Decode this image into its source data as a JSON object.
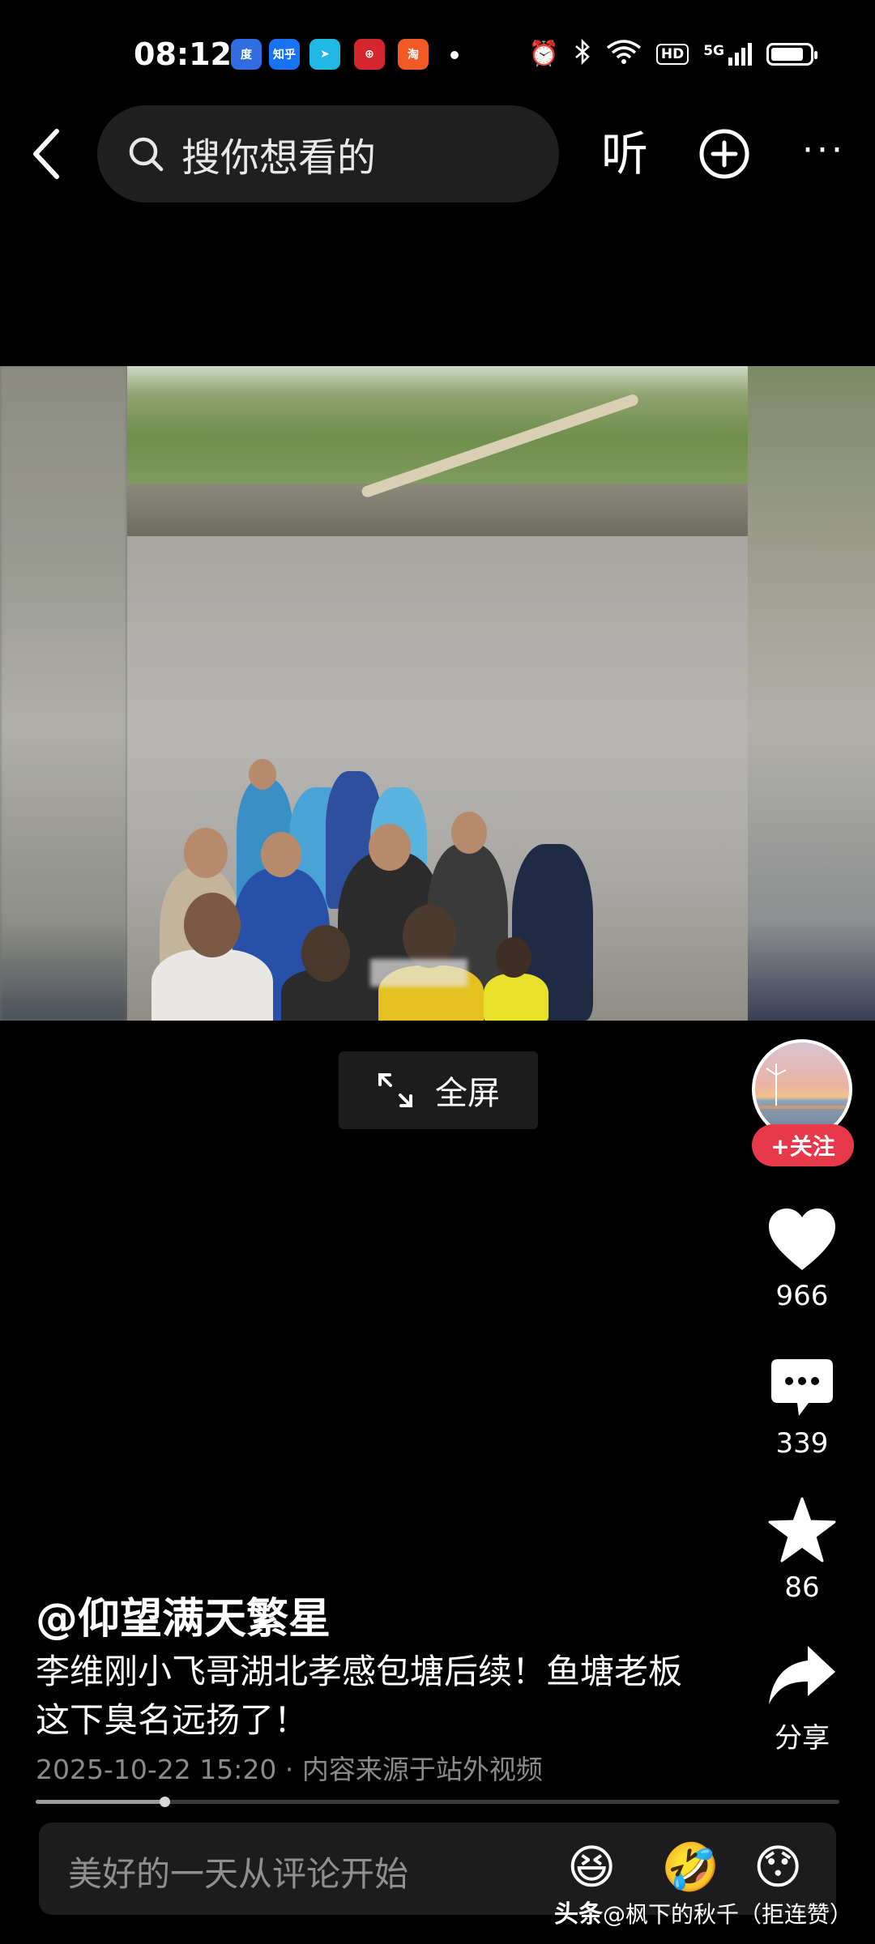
{
  "status_bar": {
    "time": "08:12",
    "apps": [
      {
        "name": "baidu-app-icon",
        "text": "度",
        "color": "#2f6de1"
      },
      {
        "name": "zhihu-app-icon",
        "text": "知乎",
        "color": "#1772f6"
      },
      {
        "name": "navigation-app-icon",
        "text": "➤",
        "color": "#22b8e6"
      },
      {
        "name": "unionpay-app-icon",
        "text": "⊕",
        "color": "#d6262d"
      },
      {
        "name": "shopping-app-icon",
        "text": "淘",
        "color": "#f15a24"
      }
    ],
    "signal_label": "5G",
    "hd_label": "HD",
    "battery_level": 0.85
  },
  "top_bar": {
    "search_placeholder": "搜你想看的",
    "listen_label": "听",
    "more_label": "···"
  },
  "video": {
    "fullscreen_label": "全屏"
  },
  "actions": {
    "follow_label": "+关注",
    "likes": "966",
    "comments": "339",
    "favorites": "86",
    "share_label": "分享"
  },
  "post": {
    "author": "@仰望满天繁星",
    "description": "李维刚小飞哥湖北孝感包塘后续！鱼塘老板这下臭名远扬了！",
    "meta": "2025-10-22 15:20 · 内容来源于站外视频",
    "progress": 0.16
  },
  "comment_bar": {
    "placeholder": "美好的一天从评论开始",
    "emojis": [
      "😆",
      "🤣",
      "😯"
    ]
  },
  "watermark": {
    "brand": "头条",
    "text": "@枫下的秋千（拒连赞）"
  },
  "colors": {
    "accent_red": "#e8394a",
    "background": "#000000"
  }
}
